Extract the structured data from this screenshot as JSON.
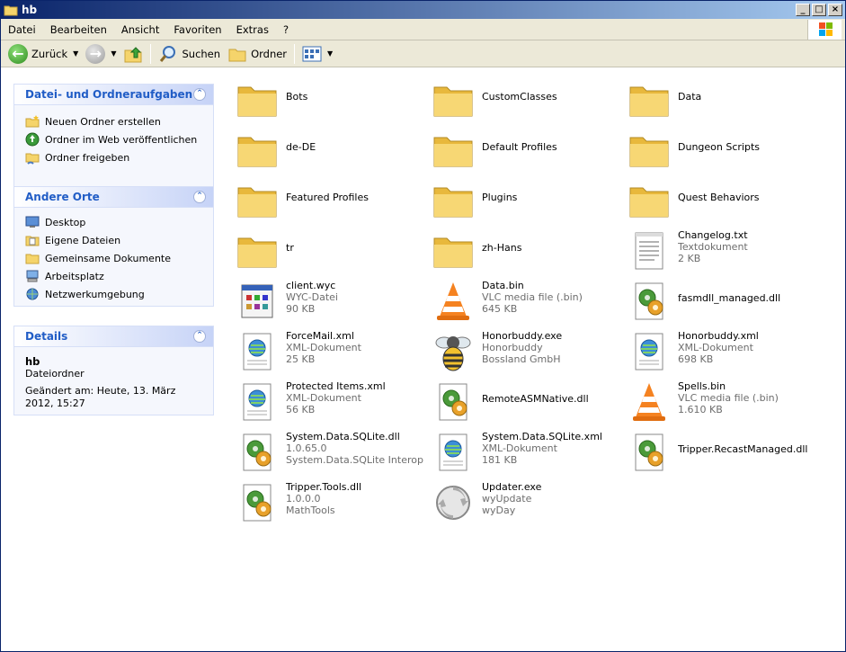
{
  "window": {
    "title": "hb"
  },
  "menu": [
    "Datei",
    "Bearbeiten",
    "Ansicht",
    "Favoriten",
    "Extras",
    "?"
  ],
  "toolbar": {
    "back": "Zurück",
    "search": "Suchen",
    "folders": "Ordner"
  },
  "panels": {
    "tasks": {
      "title": "Datei- und Ordneraufgaben",
      "items": [
        "Neuen Ordner erstellen",
        "Ordner im Web veröffentlichen",
        "Ordner freigeben"
      ]
    },
    "places": {
      "title": "Andere Orte",
      "items": [
        "Desktop",
        "Eigene Dateien",
        "Gemeinsame Dokumente",
        "Arbeitsplatz",
        "Netzwerkumgebung"
      ]
    },
    "details": {
      "title": "Details",
      "name": "hb",
      "type": "Dateiordner",
      "changed": "Geändert am: Heute, 13. März 2012, 15:27"
    }
  },
  "files": [
    {
      "name": "Bots",
      "l2": "",
      "l3": "",
      "icon": "folder"
    },
    {
      "name": "CustomClasses",
      "l2": "",
      "l3": "",
      "icon": "folder"
    },
    {
      "name": "Data",
      "l2": "",
      "l3": "",
      "icon": "folder"
    },
    {
      "name": "de-DE",
      "l2": "",
      "l3": "",
      "icon": "folder"
    },
    {
      "name": "Default Profiles",
      "l2": "",
      "l3": "",
      "icon": "folder"
    },
    {
      "name": "Dungeon Scripts",
      "l2": "",
      "l3": "",
      "icon": "folder"
    },
    {
      "name": "Featured Profiles",
      "l2": "",
      "l3": "",
      "icon": "folder"
    },
    {
      "name": "Plugins",
      "l2": "",
      "l3": "",
      "icon": "folder"
    },
    {
      "name": "Quest Behaviors",
      "l2": "",
      "l3": "",
      "icon": "folder"
    },
    {
      "name": "tr",
      "l2": "",
      "l3": "",
      "icon": "folder"
    },
    {
      "name": "zh-Hans",
      "l2": "",
      "l3": "",
      "icon": "folder"
    },
    {
      "name": "Changelog.txt",
      "l2": "Textdokument",
      "l3": "2 KB",
      "icon": "text"
    },
    {
      "name": "client.wyc",
      "l2": "WYC-Datei",
      "l3": "90 KB",
      "icon": "wyc"
    },
    {
      "name": "Data.bin",
      "l2": "VLC media file (.bin)",
      "l3": "645 KB",
      "icon": "vlc"
    },
    {
      "name": "fasmdll_managed.dll",
      "l2": "",
      "l3": "",
      "icon": "dll"
    },
    {
      "name": "ForceMail.xml",
      "l2": "XML-Dokument",
      "l3": "25 KB",
      "icon": "xml"
    },
    {
      "name": "Honorbuddy.exe",
      "l2": "Honorbuddy",
      "l3": "Bossland GmbH",
      "icon": "bee"
    },
    {
      "name": "Honorbuddy.xml",
      "l2": "XML-Dokument",
      "l3": "698 KB",
      "icon": "xml"
    },
    {
      "name": "Protected Items.xml",
      "l2": "XML-Dokument",
      "l3": "56 KB",
      "icon": "xml"
    },
    {
      "name": "RemoteASMNative.dll",
      "l2": "",
      "l3": "",
      "icon": "dll"
    },
    {
      "name": "Spells.bin",
      "l2": "VLC media file (.bin)",
      "l3": "1.610 KB",
      "icon": "vlc"
    },
    {
      "name": "System.Data.SQLite.dll",
      "l2": "1.0.65.0",
      "l3": "System.Data.SQLite Interop Li...",
      "icon": "dll"
    },
    {
      "name": "System.Data.SQLite.xml",
      "l2": "XML-Dokument",
      "l3": "181 KB",
      "icon": "xml"
    },
    {
      "name": "Tripper.RecastManaged.dll",
      "l2": "",
      "l3": "",
      "icon": "dll"
    },
    {
      "name": "Tripper.Tools.dll",
      "l2": "1.0.0.0",
      "l3": "MathTools",
      "icon": "dll"
    },
    {
      "name": "Updater.exe",
      "l2": "wyUpdate",
      "l3": "wyDay",
      "icon": "updater"
    }
  ]
}
